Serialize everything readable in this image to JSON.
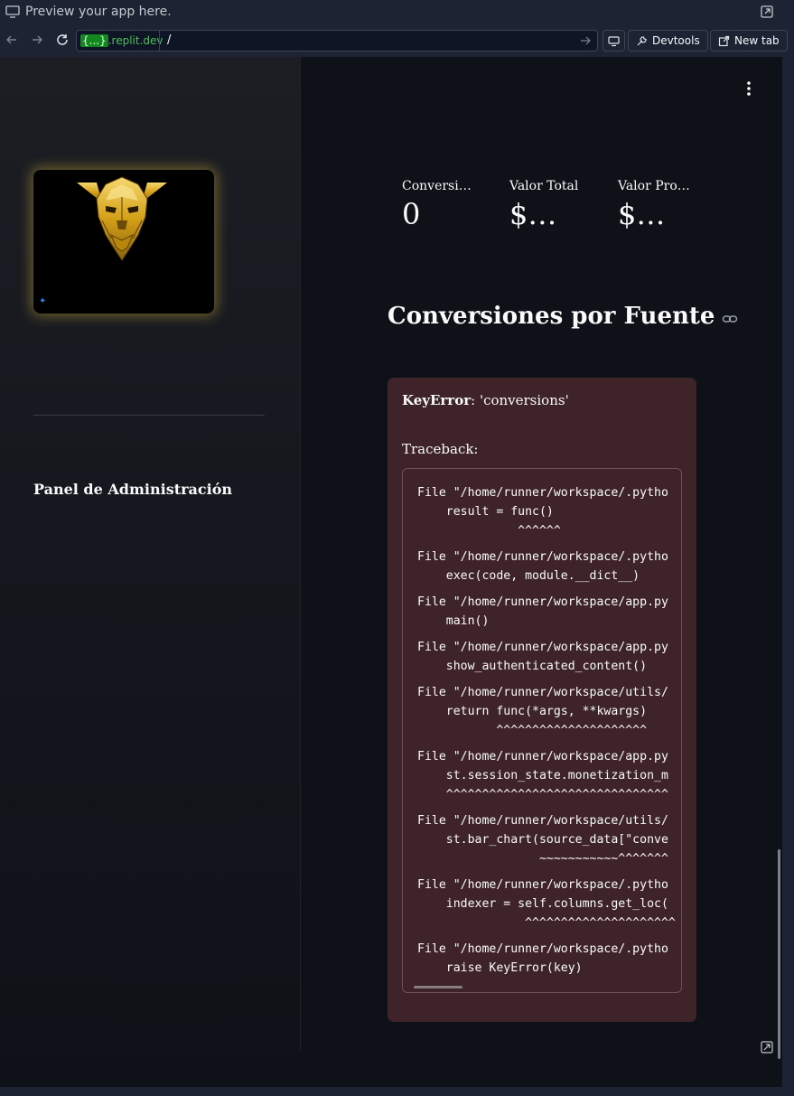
{
  "preview_bar": {
    "title": "Preview your app here."
  },
  "navbar": {
    "url_domain_highlight": "{...}",
    "url_domain_rest": ".replit.dev",
    "url_path": "/",
    "devtools_label": "Devtools",
    "new_tab_label": "New tab"
  },
  "sidebar": {
    "title": "Panel de Administración"
  },
  "metrics": [
    {
      "label": "Conversi…",
      "value": "0"
    },
    {
      "label": "Valor Total",
      "value": "$…"
    },
    {
      "label": "Valor Pro…",
      "value": "$…"
    }
  ],
  "section_title": "Conversiones por Fuente",
  "error": {
    "type": "KeyError",
    "message": ": 'conversions'",
    "traceback_label": "Traceback:",
    "frames": [
      [
        "File \"/home/runner/workspace/.pytho",
        "    result = func()",
        "              ^^^^^^"
      ],
      [
        "File \"/home/runner/workspace/.pytho",
        "    exec(code, module.__dict__)"
      ],
      [
        "File \"/home/runner/workspace/app.py",
        "    main()"
      ],
      [
        "File \"/home/runner/workspace/app.py",
        "    show_authenticated_content()"
      ],
      [
        "File \"/home/runner/workspace/utils/",
        "    return func(*args, **kwargs)",
        "           ^^^^^^^^^^^^^^^^^^^^^"
      ],
      [
        "File \"/home/runner/workspace/app.py",
        "    st.session_state.monetization_m",
        "    ^^^^^^^^^^^^^^^^^^^^^^^^^^^^^^^"
      ],
      [
        "File \"/home/runner/workspace/utils/",
        "    st.bar_chart(source_data[\"conve",
        "                 ~~~~~~~~~~~^^^^^^^"
      ],
      [
        "File \"/home/runner/workspace/.pytho",
        "    indexer = self.columns.get_loc(",
        "               ^^^^^^^^^^^^^^^^^^^^^"
      ],
      [
        "File \"/home/runner/workspace/.pytho",
        "    raise KeyError(key)"
      ]
    ]
  },
  "colors": {
    "app_bg": "#0e1117",
    "error_bg": "#3e2428",
    "gold_glow": "#d4af37"
  }
}
